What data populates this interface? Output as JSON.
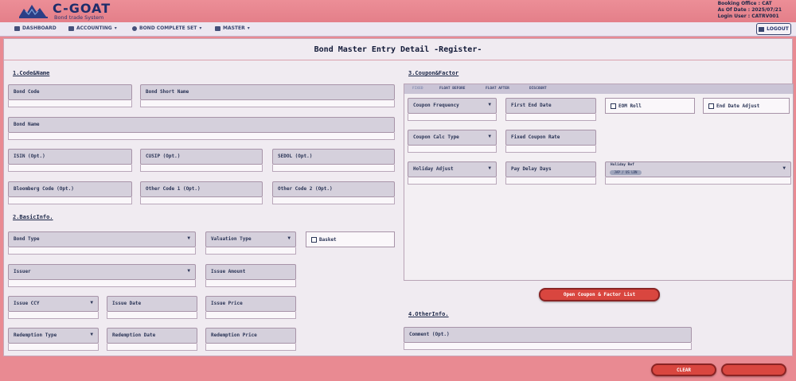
{
  "app": {
    "brand": "C-GOAT",
    "subtitle": "Bond trade System"
  },
  "user_info": {
    "booking_office": "Booking Office : CAT",
    "as_of_date": "As Of Date : 2025/07/21",
    "login_user": "Login User : CATRV001"
  },
  "nav": {
    "items": [
      {
        "label": "DASHBOARD",
        "has_dropdown": false
      },
      {
        "label": "ACCOUNTING",
        "has_dropdown": true
      },
      {
        "label": "BOND COMPLETE SET",
        "has_dropdown": true
      },
      {
        "label": "MASTER",
        "has_dropdown": true
      }
    ],
    "logout": "LOGOUT"
  },
  "page": {
    "title": "Bond Master Entry Detail -Register-"
  },
  "sections": {
    "code_name": "1.Code&Name",
    "basic_info": "2.BasicInfo.",
    "coupon_factor": "3.Coupon&Factor",
    "other_info": "4.OtherInfo."
  },
  "code_name": {
    "bond_code": "Bond Code",
    "bond_short_name": "Bond Short Name",
    "bond_name": "Bond Name",
    "isin": "ISIN (Opt.)",
    "cusip": "CUSIP (Opt.)",
    "sedol": "SEDOL (Opt.)",
    "bloomberg": "Bloomberg Code (Opt.)",
    "other_code_1": "Other Code 1 (Opt.)",
    "other_code_2": "Other Code 2 (Opt.)"
  },
  "basic_info": {
    "bond_type": "Bond Type",
    "valuation_type": "Valuation Type",
    "basket": "Basket",
    "issuer": "Issuer",
    "issue_amount": "Issue Amount",
    "issue_ccy": "Issue CCY",
    "issue_date": "Issue Date",
    "issue_price": "Issue Price",
    "redemption_type": "Redemption Type",
    "redemption_date": "Redemption Date",
    "redemption_price": "Redemption Price"
  },
  "coupon": {
    "tabs": [
      "FIXED",
      "FLOAT BEFORE",
      "FLOAT AFTER",
      "DISCOUNT"
    ],
    "active_tab": "FIXED",
    "coupon_frequency": "Coupon Frequency",
    "first_end_date": "First End Date",
    "eom_roll": "EOM Roll",
    "end_date_adjust": "End Date Adjust",
    "coupon_calc_type": "Coupon Calc Type",
    "fixed_coupon_rate": "Fixed Coupon Rate",
    "holiday_adjust": "Holiday Adjust",
    "pay_delay_days": "Pay Delay Days",
    "holiday_ref": "Holiday Ref",
    "holiday_chip": "JAP / US LDN",
    "open_list_button": "Open Coupon & Factor List"
  },
  "other_info": {
    "comment": "Comment (Opt.)"
  },
  "footer": {
    "clear": "CLEAR",
    "submit": ""
  },
  "colors": {
    "header_bg": "#e98a92",
    "panel_bg": "#f0ebf1",
    "field_bg": "#d5d0dc",
    "accent_red": "#d9463f"
  }
}
